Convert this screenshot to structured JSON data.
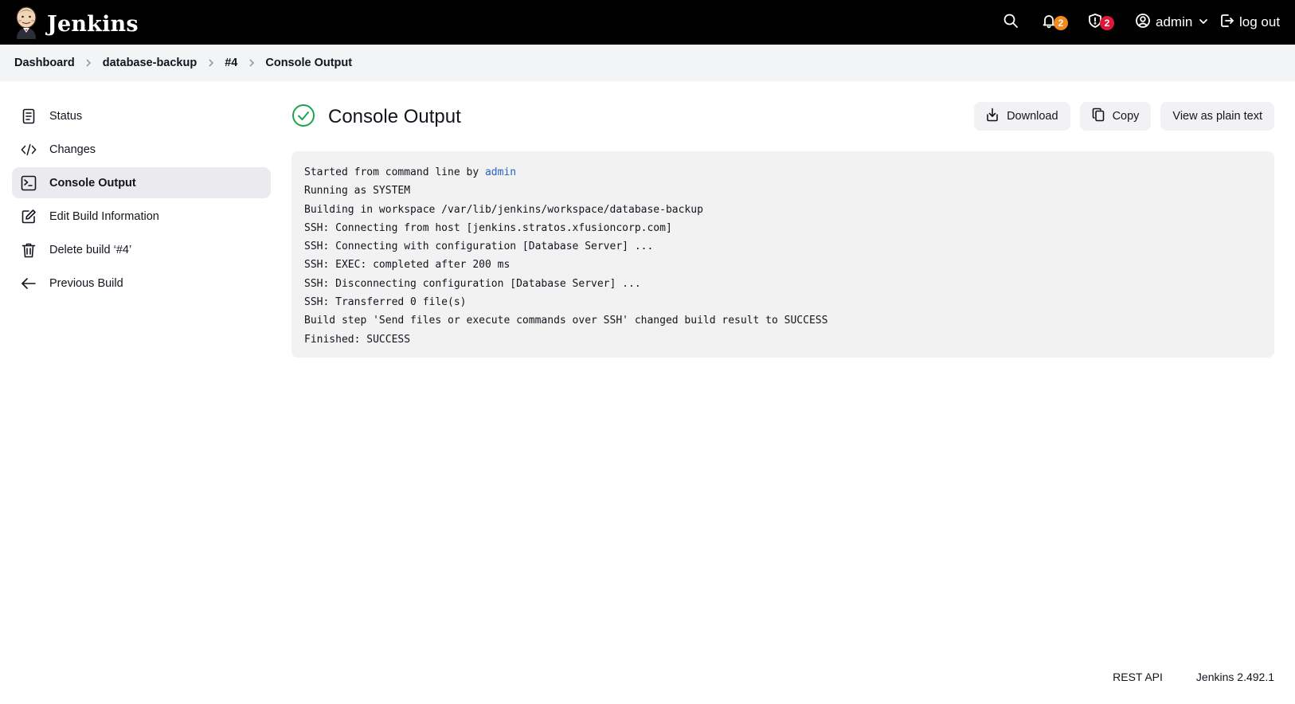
{
  "header": {
    "app_name": "Jenkins",
    "notifications_count": "2",
    "security_count": "2",
    "user_label": "admin",
    "logout_label": "log out"
  },
  "breadcrumb": [
    "Dashboard",
    "database-backup",
    "#4",
    "Console Output"
  ],
  "sidebar": {
    "items": [
      {
        "label": "Status",
        "icon": "notepad-icon"
      },
      {
        "label": "Changes",
        "icon": "code-icon"
      },
      {
        "label": "Console Output",
        "icon": "terminal-icon",
        "active": true
      },
      {
        "label": "Edit Build Information",
        "icon": "edit-icon"
      },
      {
        "label": "Delete build ‘#4’",
        "icon": "trash-icon"
      },
      {
        "label": "Previous Build",
        "icon": "arrow-left-icon"
      }
    ]
  },
  "main": {
    "title": "Console Output",
    "status": "success",
    "actions": {
      "download": "Download",
      "copy": "Copy",
      "plain_text": "View as plain text"
    },
    "console": {
      "line1_prefix": "Started from command line by ",
      "line1_link": "admin",
      "lines": [
        "Running as SYSTEM",
        "Building in workspace /var/lib/jenkins/workspace/database-backup",
        "SSH: Connecting from host [jenkins.stratos.xfusioncorp.com]",
        "SSH: Connecting with configuration [Database Server] ...",
        "SSH: EXEC: completed after 200 ms",
        "SSH: Disconnecting configuration [Database Server] ...",
        "SSH: Transferred 0 file(s)",
        "Build step 'Send files or execute commands over SSH' changed build result to SUCCESS",
        "Finished: SUCCESS"
      ]
    }
  },
  "footer": {
    "rest_api": "REST API",
    "version": "Jenkins 2.492.1"
  },
  "colors": {
    "header_bg": "#000000",
    "success": "#1ea44c",
    "notif_badge": "#f28b1b",
    "security_badge": "#e0163b",
    "link": "#2962c5"
  }
}
